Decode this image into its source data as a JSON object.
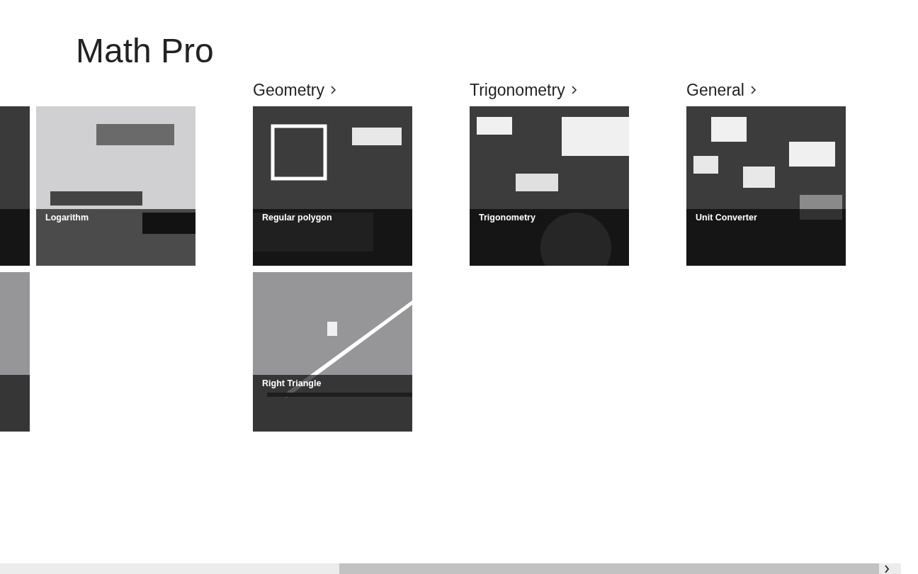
{
  "app_title": "Math Pro",
  "groups": [
    {
      "tiles": [
        {
          "kind": "picture"
        },
        {
          "kind": "picture"
        },
        {
          "kind": "picture",
          "label": "Logarithm"
        }
      ]
    },
    {
      "header": "Geometry",
      "tiles": [
        {
          "kind": "picture",
          "label": "Regular polygon"
        },
        {
          "kind": "picture",
          "label": "Right Triangle"
        }
      ]
    },
    {
      "header": "Trigonometry",
      "tiles": [
        {
          "kind": "picture",
          "label": "Trigonometry"
        }
      ]
    },
    {
      "header": "General",
      "tiles": [
        {
          "kind": "picture",
          "label": "Unit Converter"
        }
      ]
    }
  ]
}
